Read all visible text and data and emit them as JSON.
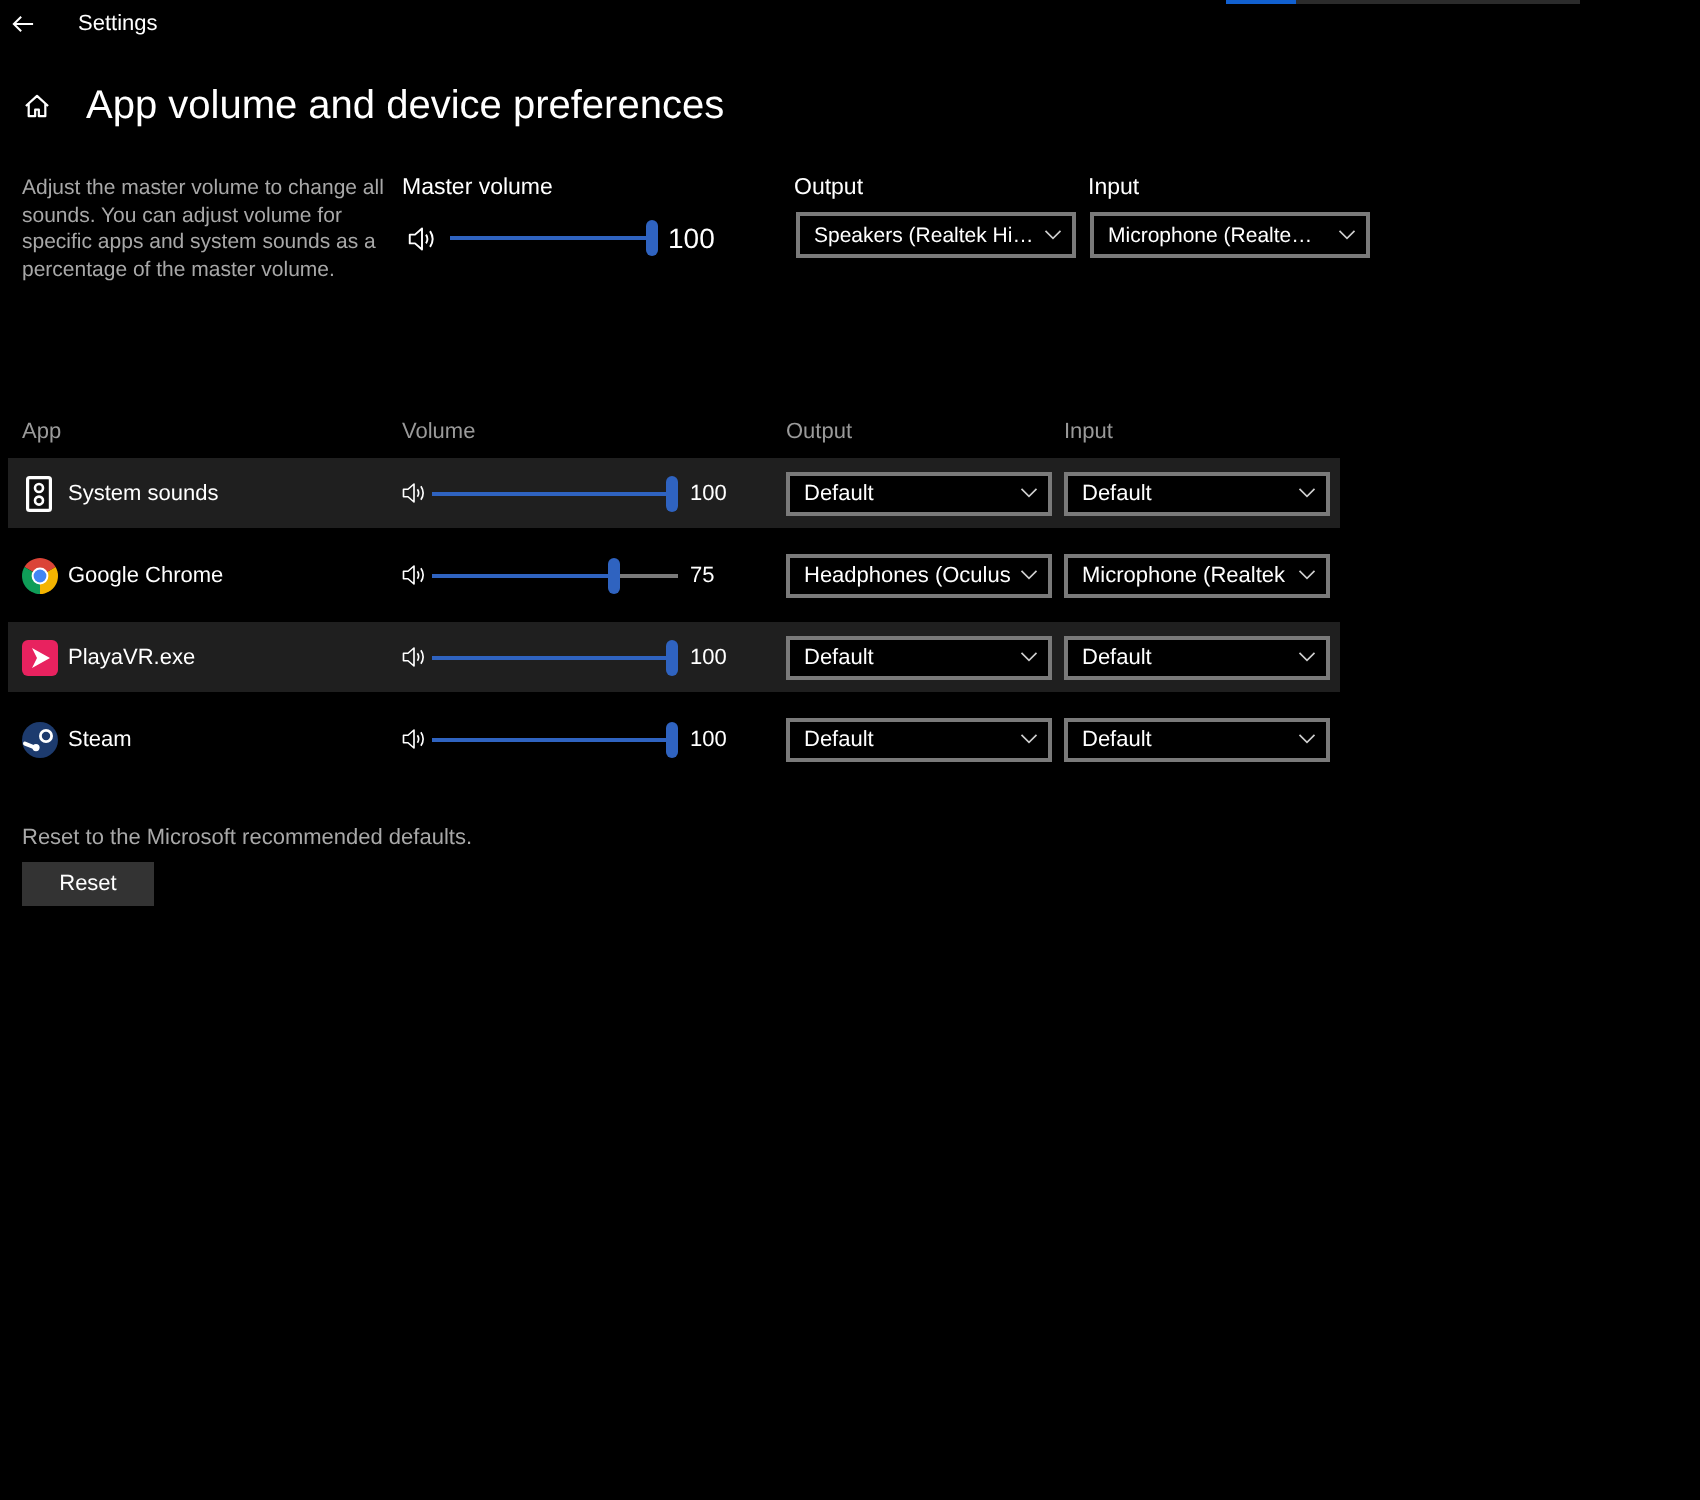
{
  "title_bar": {
    "title": "Settings",
    "progress": {
      "level": 0.2
    }
  },
  "page": {
    "title": "App volume and device preferences"
  },
  "master": {
    "description": "Adjust the master volume to change all sounds. You can adjust volume for specific apps and system sounds as a percentage of the master volume.",
    "volume": {
      "label": "Master volume",
      "level": 1,
      "reading": "100"
    },
    "output": {
      "label": "Output",
      "value": "Speakers (Realtek Hi…"
    },
    "input": {
      "label": "Input",
      "value": "Microphone (Realte…"
    }
  },
  "table": {
    "columns": [
      "App",
      "Volume",
      "Output",
      "Input"
    ],
    "rows": [
      {
        "app": "System sounds",
        "level": 1,
        "reading": "100",
        "output": "Default",
        "input": "Default"
      },
      {
        "app": "Google Chrome",
        "level": 0.75,
        "reading": "75",
        "output": "Headphones (Oculus",
        "input": "Microphone (Realtek"
      },
      {
        "app": "PlayaVR.exe",
        "level": 1,
        "reading": "100",
        "output": "Default",
        "input": "Default"
      },
      {
        "app": "Steam",
        "level": 1,
        "reading": "100",
        "output": "Default",
        "input": "Default"
      }
    ]
  },
  "reset": {
    "description": "Reset to the Microsoft recommended defaults.",
    "button": "Reset"
  }
}
